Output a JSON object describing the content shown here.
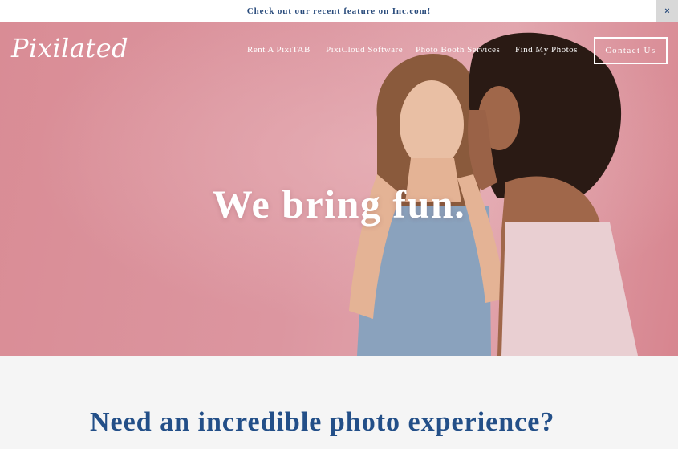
{
  "announcement": {
    "text": "Check out our recent feature on Inc.com!",
    "close_label": "×"
  },
  "header": {
    "logo_text": "Pixilated",
    "nav": [
      {
        "label": "Rent A PixiTAB"
      },
      {
        "label": "PixiCloud Software"
      },
      {
        "label": "Photo Booth Services"
      },
      {
        "label": "Find My Photos"
      }
    ],
    "contact_label": "Contact Us"
  },
  "hero": {
    "headline": "We bring fun."
  },
  "intro": {
    "title": "Need an incredible photo experience?"
  },
  "colors": {
    "brand_blue": "#234f88",
    "hero_pink": "#dc96a0",
    "white": "#ffffff"
  }
}
